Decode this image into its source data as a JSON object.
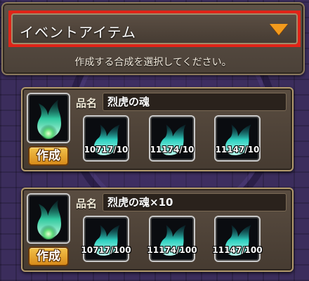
{
  "category_dropdown": {
    "selected": "イベントアイテム",
    "arrow_color": "#f39a1c",
    "highlight_color": "#e02418"
  },
  "instruction": "作成する合成を選択してください。",
  "recipes": [
    {
      "name_key": "品名",
      "item_name": "烈虎の魂",
      "make_label": "作成",
      "output_icon": "green-flame-icon",
      "materials": [
        {
          "icon": "cyan-flame-icon",
          "count": "10717/10"
        },
        {
          "icon": "cyan-flame-icon",
          "count": "11174/10"
        },
        {
          "icon": "cyan-flame-icon",
          "count": "11147/10"
        }
      ]
    },
    {
      "name_key": "品名",
      "item_name": "烈虎の魂×10",
      "make_label": "作成",
      "output_icon": "green-flame-icon",
      "materials": [
        {
          "icon": "cyan-flame-icon",
          "count": "10717/100"
        },
        {
          "icon": "cyan-flame-icon",
          "count": "11174/100"
        },
        {
          "icon": "cyan-flame-icon",
          "count": "11147/100"
        }
      ]
    }
  ]
}
